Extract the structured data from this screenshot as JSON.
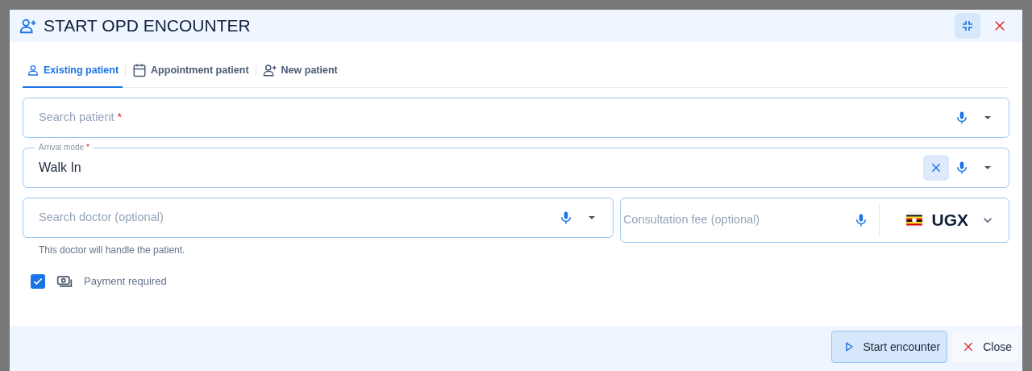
{
  "dialog": {
    "title": "START OPD ENCOUNTER"
  },
  "tabs": [
    {
      "label": "Existing patient",
      "kind": "person",
      "selected": true
    },
    {
      "label": "Appointment patient",
      "kind": "calendar",
      "selected": false
    },
    {
      "label": "New patient",
      "kind": "person-add",
      "selected": false
    }
  ],
  "patient_field": {
    "placeholder": "Search patient",
    "required_mark": "*"
  },
  "arrival_field": {
    "label": "Arrival mode",
    "required_mark": "*",
    "value": "Walk In"
  },
  "doctor_field": {
    "placeholder": "Search doctor (optional)",
    "helper": "This doctor will handle the patient."
  },
  "fee_field": {
    "placeholder": "Consultation fee (optional)",
    "currency": "UGX"
  },
  "payment": {
    "label": "Payment required",
    "checked": true
  },
  "footer": {
    "buttons": [
      {
        "label": "Start encounter",
        "kind": "primary"
      },
      {
        "label": "Close",
        "kind": "close"
      }
    ]
  }
}
